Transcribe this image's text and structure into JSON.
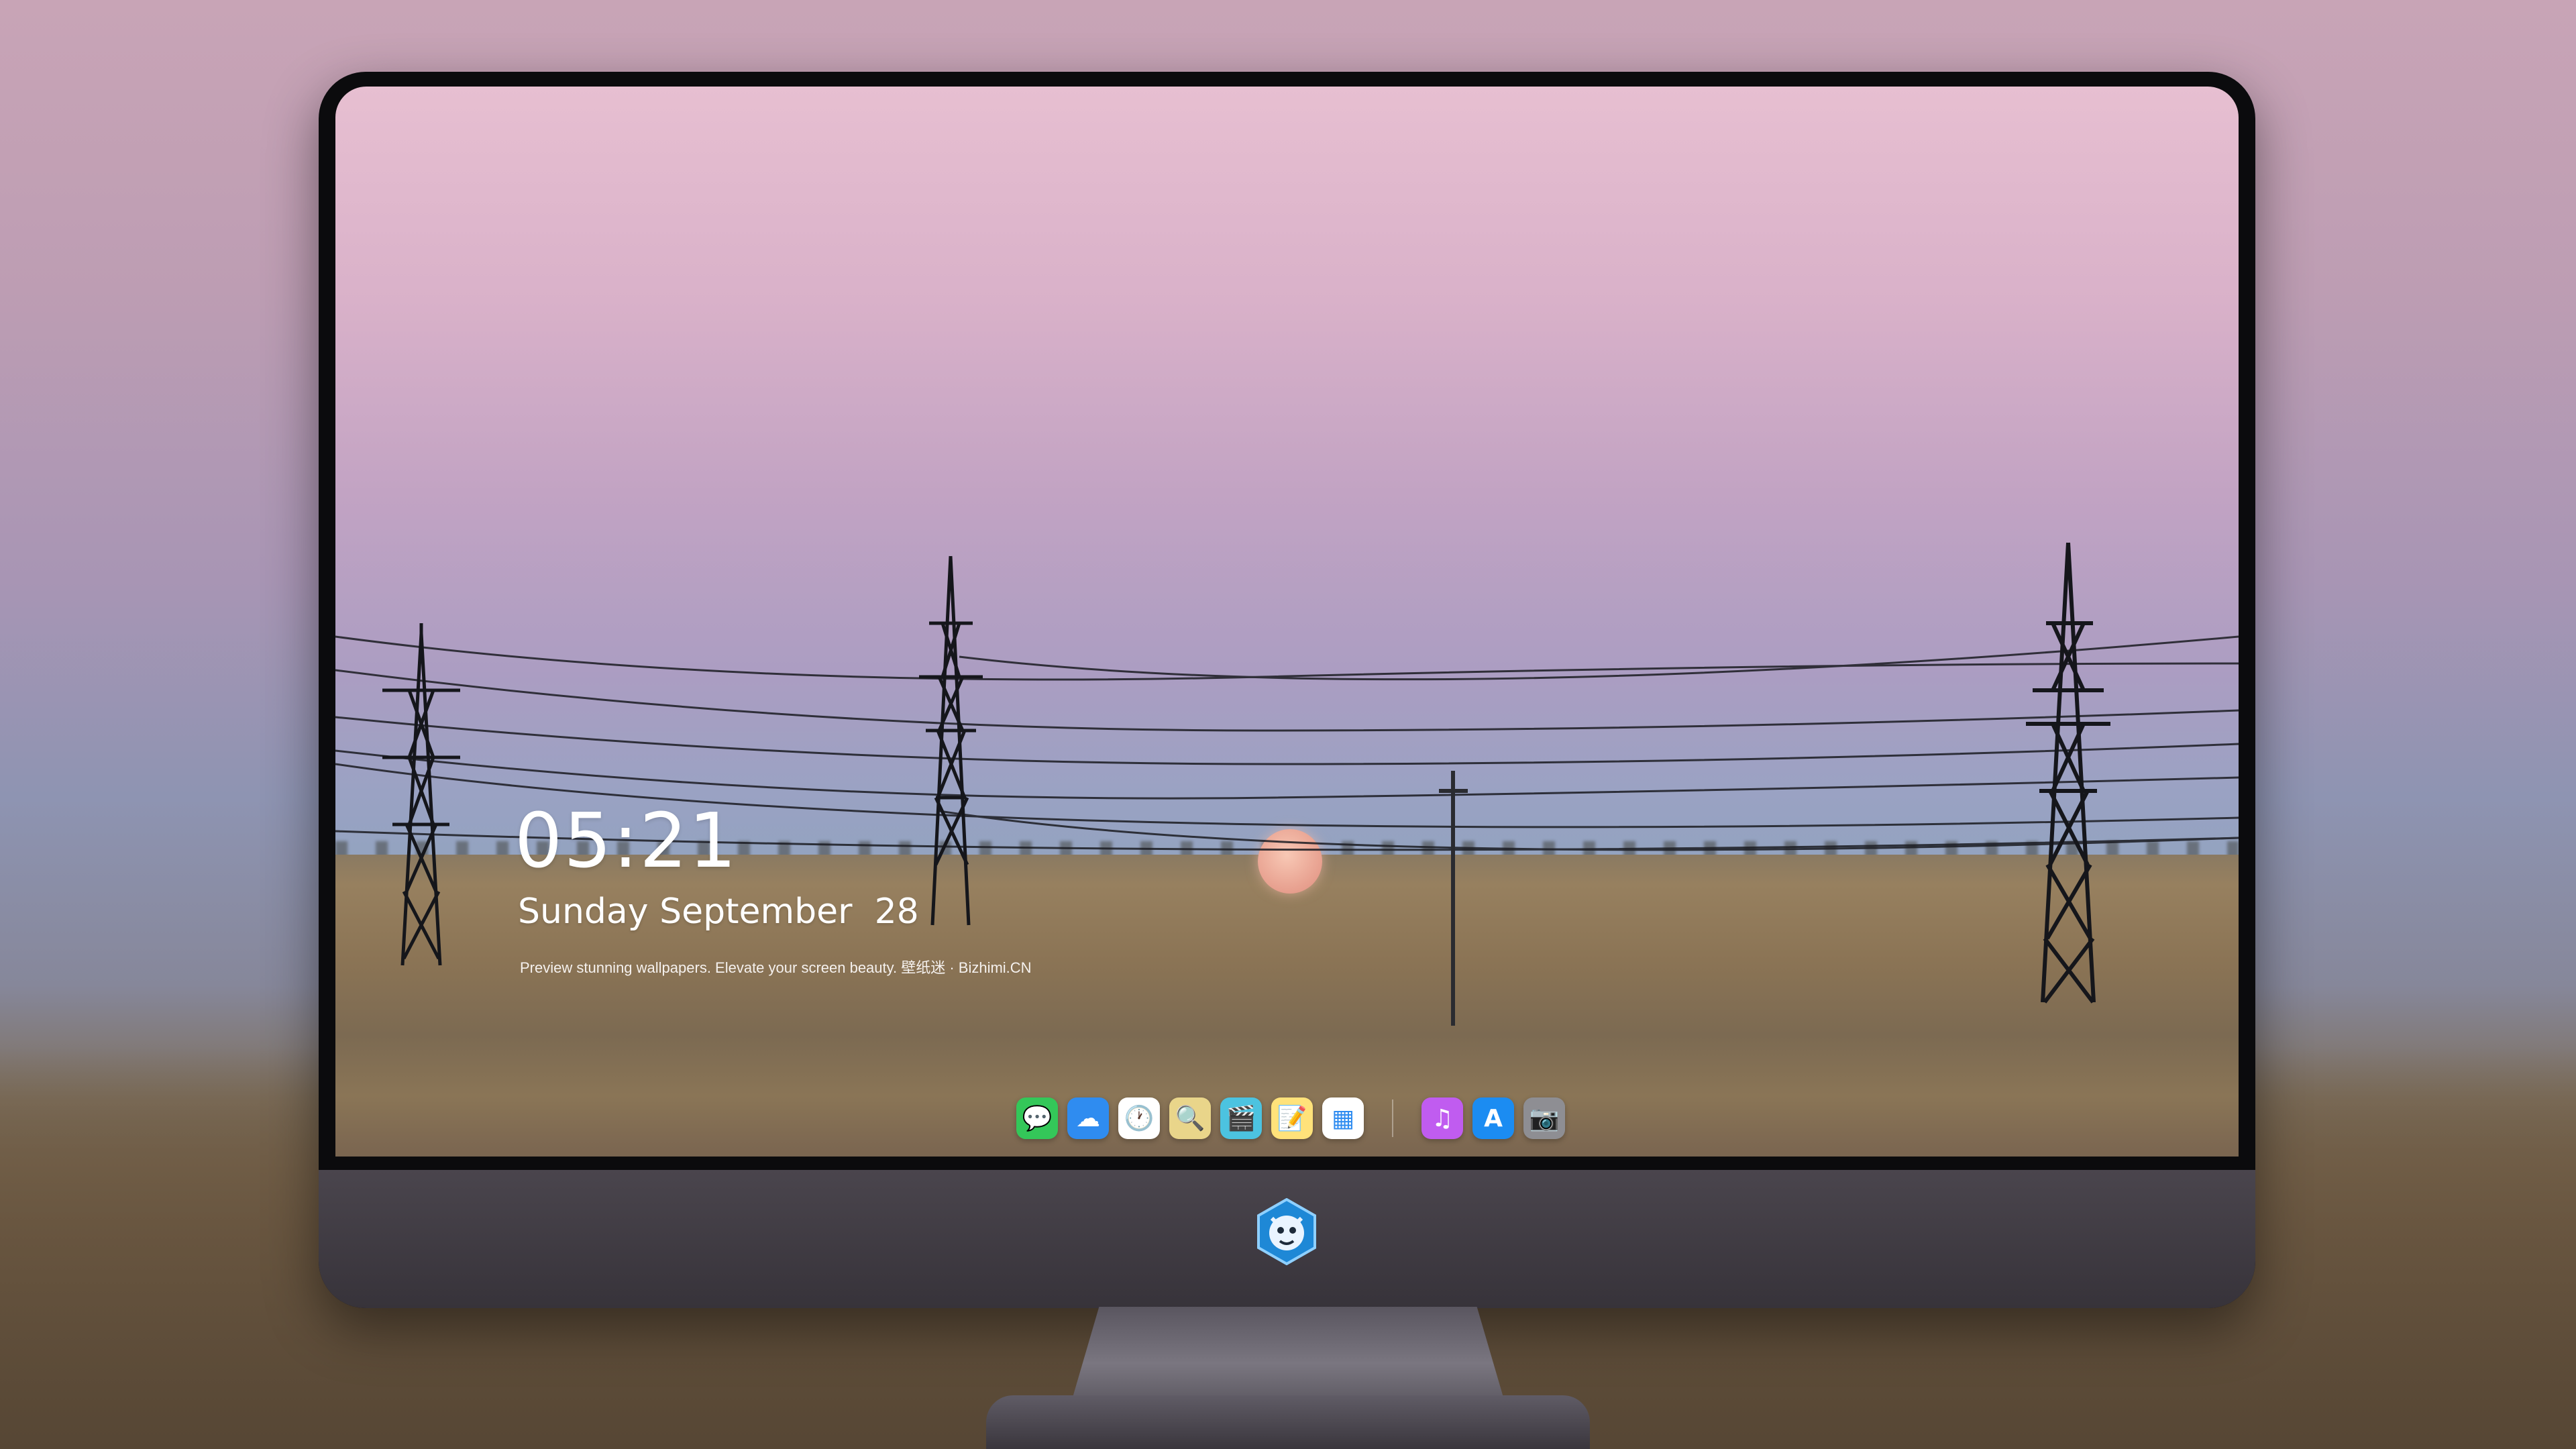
{
  "clock": {
    "time": "05:21",
    "date": "Sunday September  28"
  },
  "tagline": "Preview stunning wallpapers. Elevate your screen beauty. 壁纸迷 · Bizhimi.CN",
  "dock": {
    "apps": [
      {
        "name": "Messages",
        "icon": "messages-icon",
        "glyph": "💬",
        "color": "#34c759"
      },
      {
        "name": "Weather",
        "icon": "weather-icon",
        "glyph": "☁",
        "color": "#2f8cf0"
      },
      {
        "name": "Clock",
        "icon": "clock-icon",
        "glyph": "🕐",
        "color": "#ffffff"
      },
      {
        "name": "Preview",
        "icon": "preview-icon",
        "glyph": "🔍",
        "color": "#e9d58a"
      },
      {
        "name": "Clips",
        "icon": "clips-icon",
        "glyph": "🎬",
        "color": "#4cc3e0"
      },
      {
        "name": "Notes",
        "icon": "notes-icon",
        "glyph": "📝",
        "color": "#ffe27a"
      },
      {
        "name": "Calendar",
        "icon": "calendar-icon",
        "glyph": "▦",
        "color": "#ffffff"
      },
      {
        "name": "iTunes",
        "icon": "itunes-icon",
        "glyph": "♫",
        "color": "#c05cf0"
      },
      {
        "name": "App Store",
        "icon": "app-store-icon",
        "glyph": "A",
        "color": "#1b8cf2"
      },
      {
        "name": "Camera",
        "icon": "camera-icon",
        "glyph": "📷",
        "color": "#8e8e93"
      }
    ]
  }
}
